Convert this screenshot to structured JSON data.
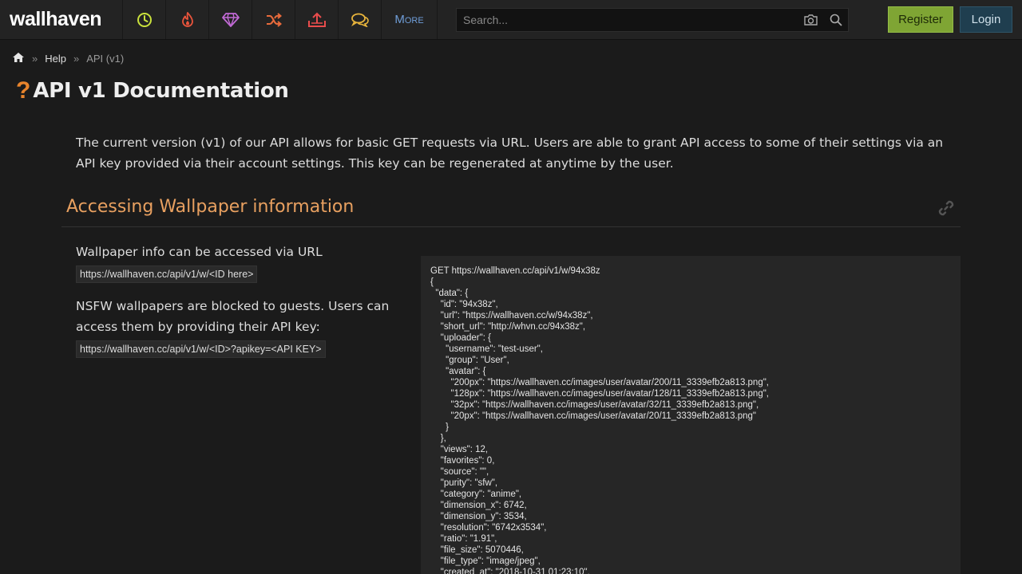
{
  "header": {
    "logo": "wallhaven",
    "nav": [
      {
        "name": "latest-button",
        "icon": "clock-icon",
        "color": "#c9e13c"
      },
      {
        "name": "hot-button",
        "icon": "flame-icon",
        "color": "#e9543c"
      },
      {
        "name": "toplist-button",
        "icon": "diamond-icon",
        "color": "#c26ad6"
      },
      {
        "name": "random-button",
        "icon": "shuffle-icon",
        "color": "#e96b3c"
      },
      {
        "name": "upload-button",
        "icon": "upload-icon",
        "color": "#e94c4c"
      },
      {
        "name": "forums-button",
        "icon": "chat-icon",
        "color": "#e9b53c"
      }
    ],
    "more_label": "More",
    "search_placeholder": "Search...",
    "register_label": "Register",
    "login_label": "Login"
  },
  "breadcrumb": {
    "help": "Help",
    "sep1": "»",
    "sep2": "»",
    "current": "API (v1)"
  },
  "page": {
    "title_mark": "?",
    "title": "API v1 Documentation",
    "intro": "The current version (v1) of our API allows for basic GET requests via URL. Users are able to grant API access to some of their settings via an API key provided via their account settings. This key can be regenerated at anytime by the user."
  },
  "section": {
    "heading": "Accessing Wallpaper information",
    "info_text": "Wallpaper info can be accessed via URL",
    "info_url": "https://wallhaven.cc/api/v1/w/<ID here>",
    "nsfw_text": "NSFW wallpapers are blocked to guests. Users can access them by providing their API key:",
    "nsfw_url": "https://wallhaven.cc/api/v1/w/<ID>?apikey=<API KEY>"
  },
  "code": {
    "lines": [
      "GET https://wallhaven.cc/api/v1/w/94x38z",
      "{",
      "  \"data\": {",
      "    \"id\": \"94x38z\",",
      "    \"url\": \"https://wallhaven.cc/w/94x38z\",",
      "    \"short_url\": \"http://whvn.cc/94x38z\",",
      "    \"uploader\": {",
      "      \"username\": \"test-user\",",
      "      \"group\": \"User\",",
      "      \"avatar\": {",
      "        \"200px\": \"https://wallhaven.cc/images/user/avatar/200/11_3339efb2a813.png\",",
      "        \"128px\": \"https://wallhaven.cc/images/user/avatar/128/11_3339efb2a813.png\",",
      "        \"32px\": \"https://wallhaven.cc/images/user/avatar/32/11_3339efb2a813.png\",",
      "        \"20px\": \"https://wallhaven.cc/images/user/avatar/20/11_3339efb2a813.png\"",
      "      }",
      "    },",
      "    \"views\": 12,",
      "    \"favorites\": 0,",
      "    \"source\": \"\",",
      "    \"purity\": \"sfw\",",
      "    \"category\": \"anime\",",
      "    \"dimension_x\": 6742,",
      "    \"dimension_y\": 3534,",
      "    \"resolution\": \"6742x3534\",",
      "    \"ratio\": \"1.91\",",
      "    \"file_size\": 5070446,",
      "    \"file_type\": \"image/jpeg\",",
      "    \"created_at\": \"2018-10-31 01:23:10\","
    ]
  }
}
